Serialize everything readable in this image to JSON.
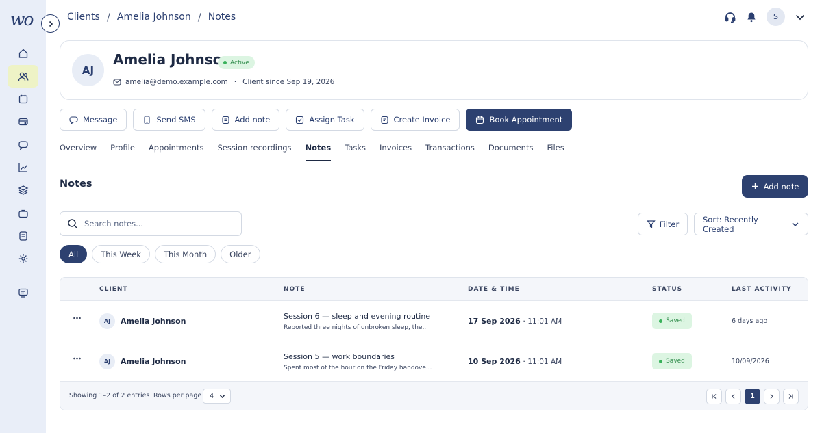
{
  "brand": {
    "logo_text": "wo"
  },
  "breadcrumb": [
    "Clients",
    "Amelia Johnson",
    "Notes"
  ],
  "header": {
    "user_initial": "S"
  },
  "sidebar": {
    "items": [
      {
        "icon": "home-icon"
      },
      {
        "icon": "users-icon",
        "active": true
      },
      {
        "icon": "calendar-icon"
      },
      {
        "icon": "wallet-icon"
      },
      {
        "icon": "chat-icon"
      },
      {
        "icon": "chart-icon"
      },
      {
        "icon": "layers-icon"
      },
      {
        "icon": "briefcase-icon"
      },
      {
        "icon": "document-icon"
      },
      {
        "icon": "gear-icon"
      },
      {
        "icon": "monitor-icon"
      }
    ]
  },
  "client": {
    "initials": "AJ",
    "name": "Amelia Johnson",
    "status": "Active",
    "email": "amelia@demo.example.com",
    "since": "Client since Sep 19, 2026"
  },
  "actions": [
    "Message",
    "Send SMS",
    "Add note",
    "Assign Task",
    "Create Invoice",
    "Book Appointment"
  ],
  "tabs": [
    "Overview",
    "Profile",
    "Appointments",
    "Session recordings",
    "Notes",
    "Tasks",
    "Invoices",
    "Transactions",
    "Documents",
    "Files"
  ],
  "notes": {
    "title": "Notes",
    "add_label": "Add note",
    "search_placeholder": "Search notes...",
    "filter_label": "Filter",
    "sort_label": "Sort: Recently Created",
    "chips": [
      "All",
      "This Week",
      "This Month",
      "Older"
    ],
    "columns": [
      "CLIENT",
      "NOTE",
      "DATE & TIME",
      "STATUS",
      "LAST ACTIVITY"
    ],
    "rows": [
      {
        "initials": "AJ",
        "client": "Amelia Johnson",
        "title": "Session 6 — sleep and evening routine",
        "snippet": "Reported three nights of unbroken sleep, the...",
        "date": "17 Sep 2026",
        "time": "11:01 AM",
        "status": "Saved",
        "last": "6 days ago"
      },
      {
        "initials": "AJ",
        "client": "Amelia Johnson",
        "title": "Session 5 — work boundaries",
        "snippet": "Spent most of the hour on the Friday handove...",
        "date": "10 Sep 2026",
        "time": "11:01 AM",
        "status": "Saved",
        "last": "10/09/2026"
      }
    ],
    "footer": {
      "showing": "Showing 1–2 of 2 entries",
      "rows_per_page_label": "Rows per page",
      "rows_per_page": "4",
      "current_page": "1"
    }
  }
}
